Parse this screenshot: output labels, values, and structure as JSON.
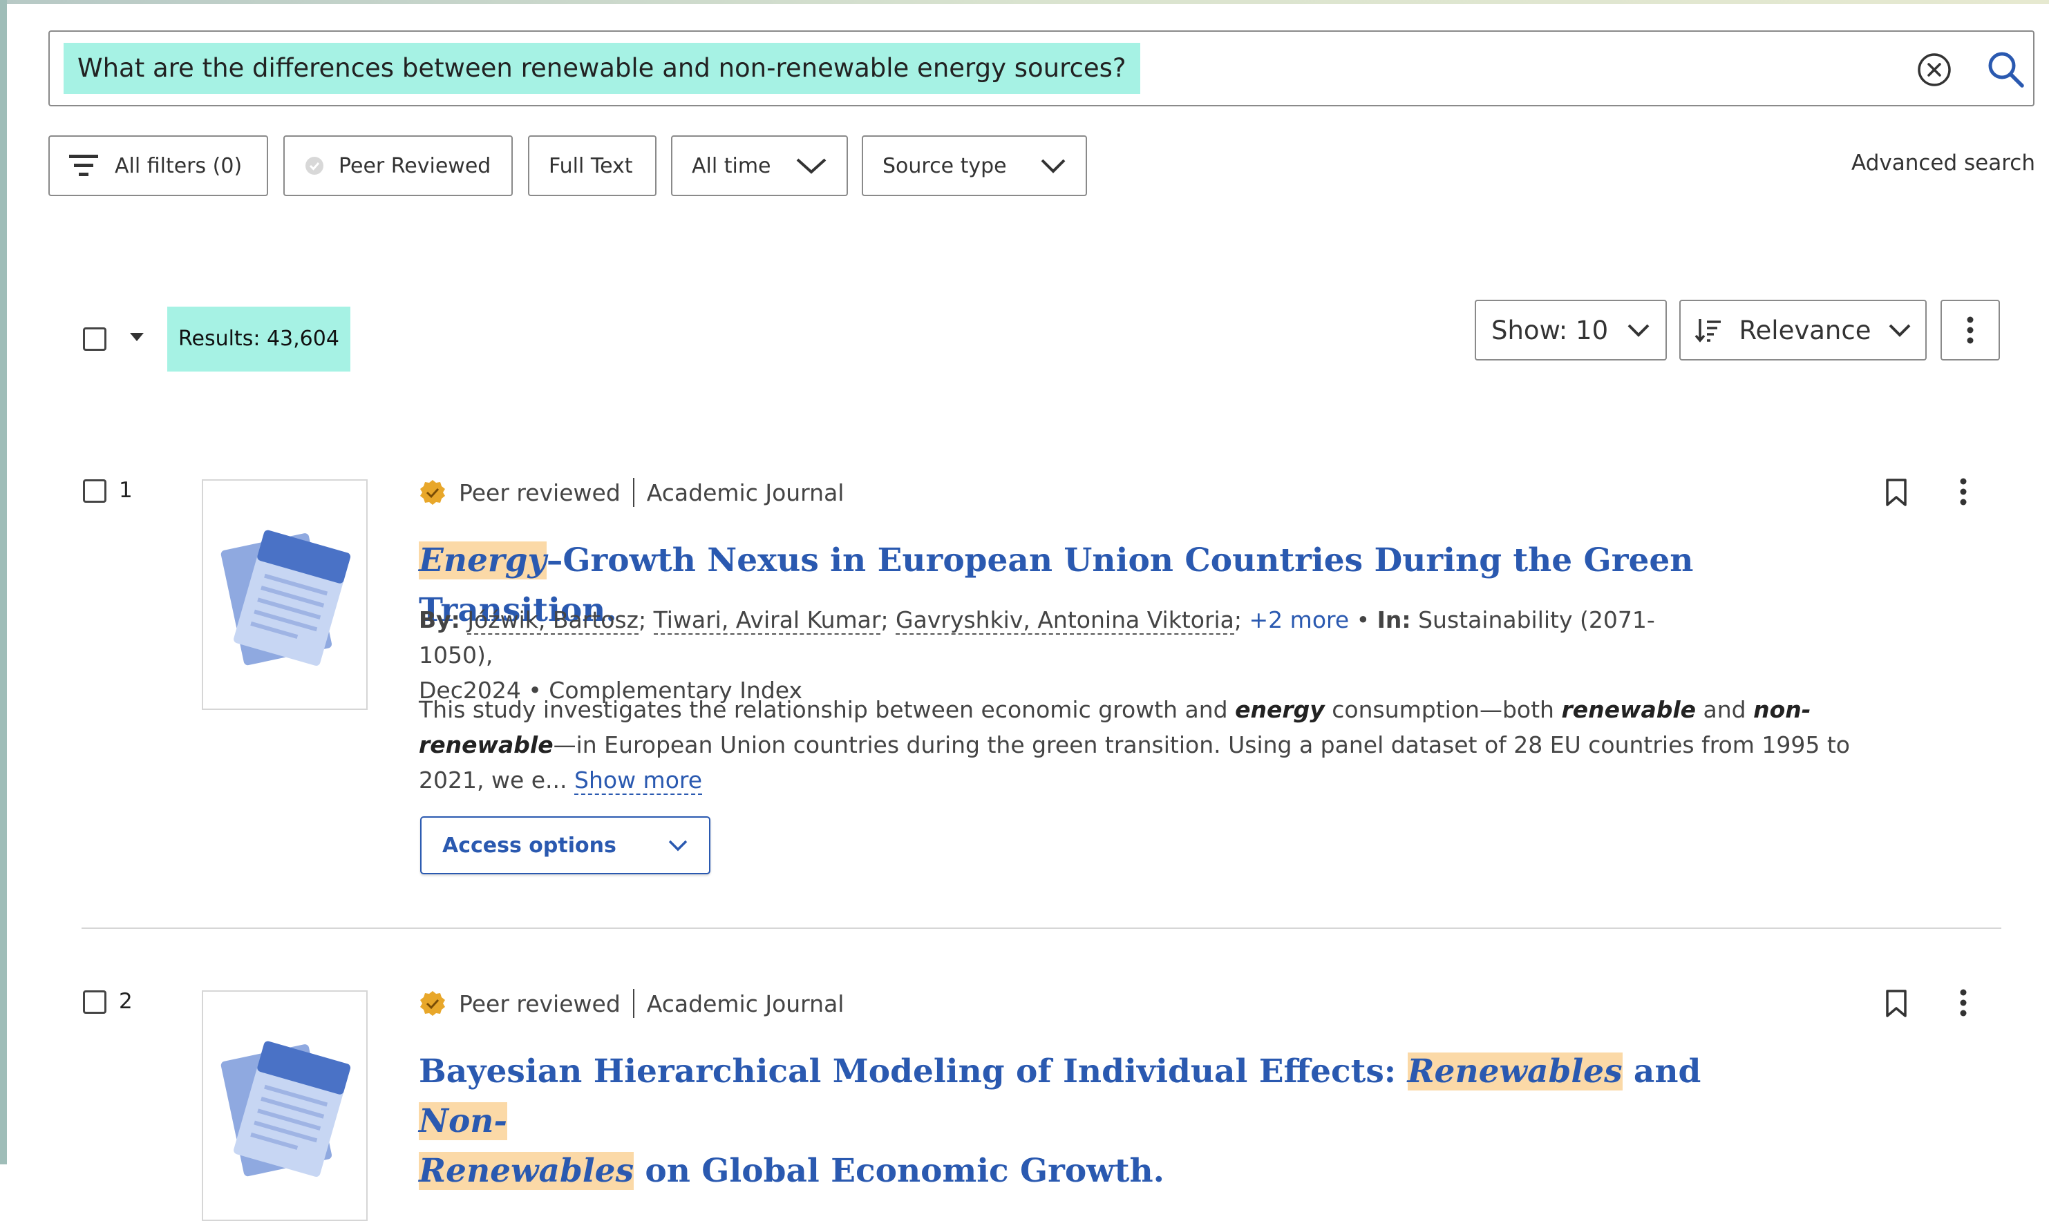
{
  "search": {
    "query": "What are the differences between renewable and non-renewable energy sources?"
  },
  "filters": {
    "all_filters": "All filters (0)",
    "peer_reviewed": "Peer Reviewed",
    "full_text": "Full Text",
    "all_time": "All time",
    "source_type": "Source type",
    "advanced_search": "Advanced search"
  },
  "results_header": {
    "count": "Results: 43,604",
    "show": "Show: 10",
    "sort": "Relevance"
  },
  "results": [
    {
      "number": "1",
      "peer_reviewed": "Peer reviewed",
      "source_type": "Academic Journal",
      "title_highlight": "Energy",
      "title_rest": "–Growth Nexus in European Union Countries During the Green Transition.",
      "by_label": "By:",
      "authors": [
        "Jóźwik, Bartosz",
        "Tiwari, Aviral Kumar",
        "Gavryshkiv, Antonina Viktoria"
      ],
      "more_authors": "+2 more",
      "in_label": "In:",
      "publication": "Sustainability (2071-1050),",
      "date_db": "Dec2024 • Complementary Index",
      "abstract_1": "This study investigates the relationship between economic growth and ",
      "abstract_kw1": "energy",
      "abstract_2": " consumption—both ",
      "abstract_kw2": "renewable",
      "abstract_3": " and ",
      "abstract_kw3": "non-renewable",
      "abstract_4": "—in European Union countries during the green transition. Using a panel dataset of 28 EU countries from 1995 to 2021, we e... ",
      "show_more": "Show more",
      "access_options": "Access options"
    },
    {
      "number": "2",
      "peer_reviewed": "Peer reviewed",
      "source_type": "Academic Journal",
      "title_1": "Bayesian Hierarchical Modeling of Individual Effects: ",
      "title_hl1": "Renewables",
      "title_2": " and ",
      "title_hl2": "Non-",
      "title_hl3": "Renewables",
      "title_3": " on Global Economic Growth."
    }
  ],
  "colors": {
    "accent_blue": "#2a59b0",
    "highlight_teal": "#a6f2e4",
    "highlight_orange": "#fbd9a7",
    "badge_gold": "#e8a72a"
  }
}
